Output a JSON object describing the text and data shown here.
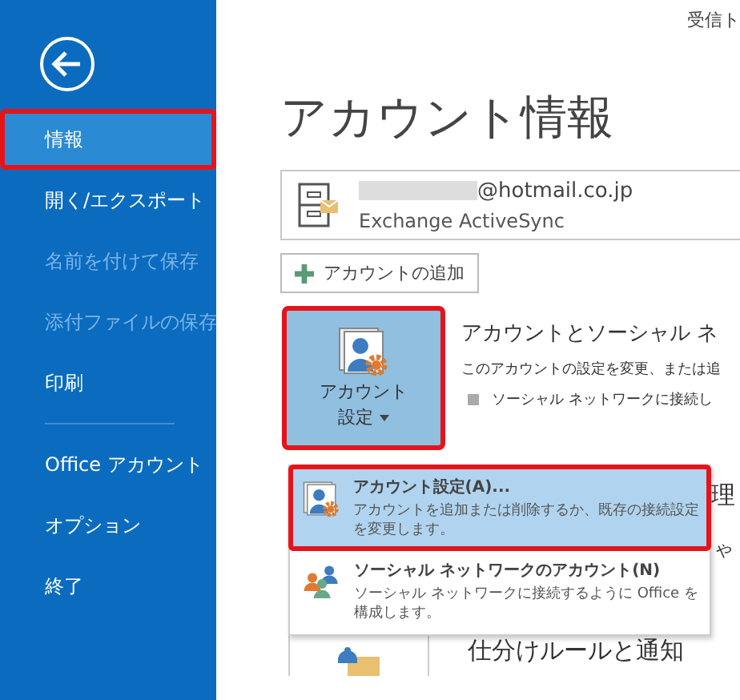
{
  "sidebar": {
    "items": [
      {
        "label": "情報",
        "selected": true,
        "disabled": false,
        "highlighted": true
      },
      {
        "label": "開く/エクスポート",
        "selected": false,
        "disabled": false,
        "highlighted": false
      },
      {
        "label": "名前を付けて保存",
        "selected": false,
        "disabled": true,
        "highlighted": false
      },
      {
        "label": "添付ファイルの保存",
        "selected": false,
        "disabled": true,
        "highlighted": false
      },
      {
        "label": "印刷",
        "selected": false,
        "disabled": false,
        "highlighted": false
      },
      {
        "label": "Office アカウント",
        "selected": false,
        "disabled": false,
        "highlighted": false,
        "divider_before": true
      },
      {
        "label": "オプション",
        "selected": false,
        "disabled": false,
        "highlighted": false
      },
      {
        "label": "終了",
        "selected": false,
        "disabled": false,
        "highlighted": false
      }
    ]
  },
  "header_text": "受信ト",
  "title": "アカウント情報",
  "account": {
    "email_suffix": "@hotmail.co.jp",
    "type": "Exchange ActiveSync"
  },
  "add_account_button": "アカウントの追加",
  "account_settings_button": {
    "line1": "アカウント",
    "line2": "設定",
    "highlighted": true
  },
  "section": {
    "heading": "アカウントとソーシャル ネ",
    "description": "このアカウントの設定を変更、または追",
    "bullet": "ソーシャル ネットワークに接続し"
  },
  "menu": {
    "items": [
      {
        "title": "アカウント設定(A)...",
        "description": "アカウントを追加または削除するか、既存の接続設定を変更します。",
        "kind": "settings",
        "selected": true,
        "highlighted": true
      },
      {
        "title": "ソーシャル ネットワークのアカウント(N)",
        "description": "ソーシャル ネットワークに接続するように Office を構成します。",
        "kind": "people",
        "selected": false,
        "highlighted": false
      }
    ]
  },
  "behind_fragments": [
    "理",
    "や"
  ],
  "rules_heading": "仕分けルールと通知"
}
